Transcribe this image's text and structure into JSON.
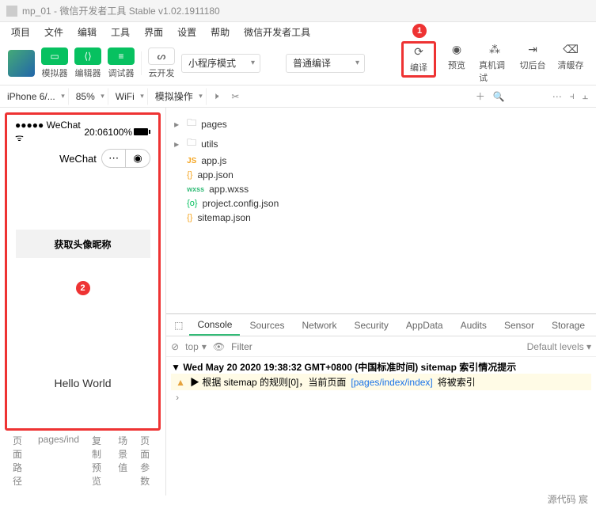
{
  "titlebar": {
    "text": "mp_01 - 微信开发者工具 Stable v1.02.1911180"
  },
  "menubar": [
    "项目",
    "文件",
    "编辑",
    "工具",
    "界面",
    "设置",
    "帮助",
    "微信开发者工具"
  ],
  "toolbar": {
    "sim": "模拟器",
    "editor": "编辑器",
    "debugger": "调试器",
    "cloud": "云开发",
    "mode": "小程序模式",
    "compile_mode": "普通编译",
    "right": [
      {
        "icon": "⟳",
        "label": "编译"
      },
      {
        "icon": "◉",
        "label": "预览"
      },
      {
        "icon": "⁂",
        "label": "真机调试"
      },
      {
        "icon": "⇥",
        "label": "切后台"
      },
      {
        "icon": "⌫",
        "label": "清缓存"
      }
    ]
  },
  "badges": {
    "one": "1",
    "two": "2"
  },
  "subbar": {
    "device": "iPhone 6/...",
    "zoom": "85%",
    "network": "WiFi",
    "mock": "模拟操作"
  },
  "simulator": {
    "carrier": "WeChat",
    "time": "20:06",
    "battery": "100%",
    "title": "WeChat",
    "button": "获取头像昵称",
    "hello": "Hello World",
    "tabs": [
      "页面路径",
      "pages/ind",
      "复制 预览",
      "场景值",
      "页面参数"
    ]
  },
  "tree": {
    "pages": "pages",
    "utils": "utils",
    "files": [
      {
        "badge": "JS",
        "name": "app.js",
        "cls": "js-badge"
      },
      {
        "badge": "{}",
        "name": "app.json",
        "cls": "json-badge"
      },
      {
        "badge": "wxss",
        "name": "app.wxss",
        "cls": "wxss-badge"
      },
      {
        "badge": "{o}",
        "name": "project.config.json",
        "cls": "cfg-badge"
      },
      {
        "badge": "{}",
        "name": "sitemap.json",
        "cls": "json-badge"
      }
    ]
  },
  "devtools": {
    "tabs": [
      "Console",
      "Sources",
      "Network",
      "Security",
      "AppData",
      "Audits",
      "Sensor",
      "Storage"
    ],
    "top": "top",
    "filter_ph": "Filter",
    "levels": "Default levels ▾",
    "log1": "Wed May 20 2020 19:38:32 GMT+0800 (中国标准时间) sitemap 索引情况提示",
    "warn_a": "▶ 根据 sitemap 的规则[0]，当前页面",
    "warn_b": "[pages/index/index]",
    "warn_c": "将被索引"
  },
  "footer": "源代码   宸"
}
